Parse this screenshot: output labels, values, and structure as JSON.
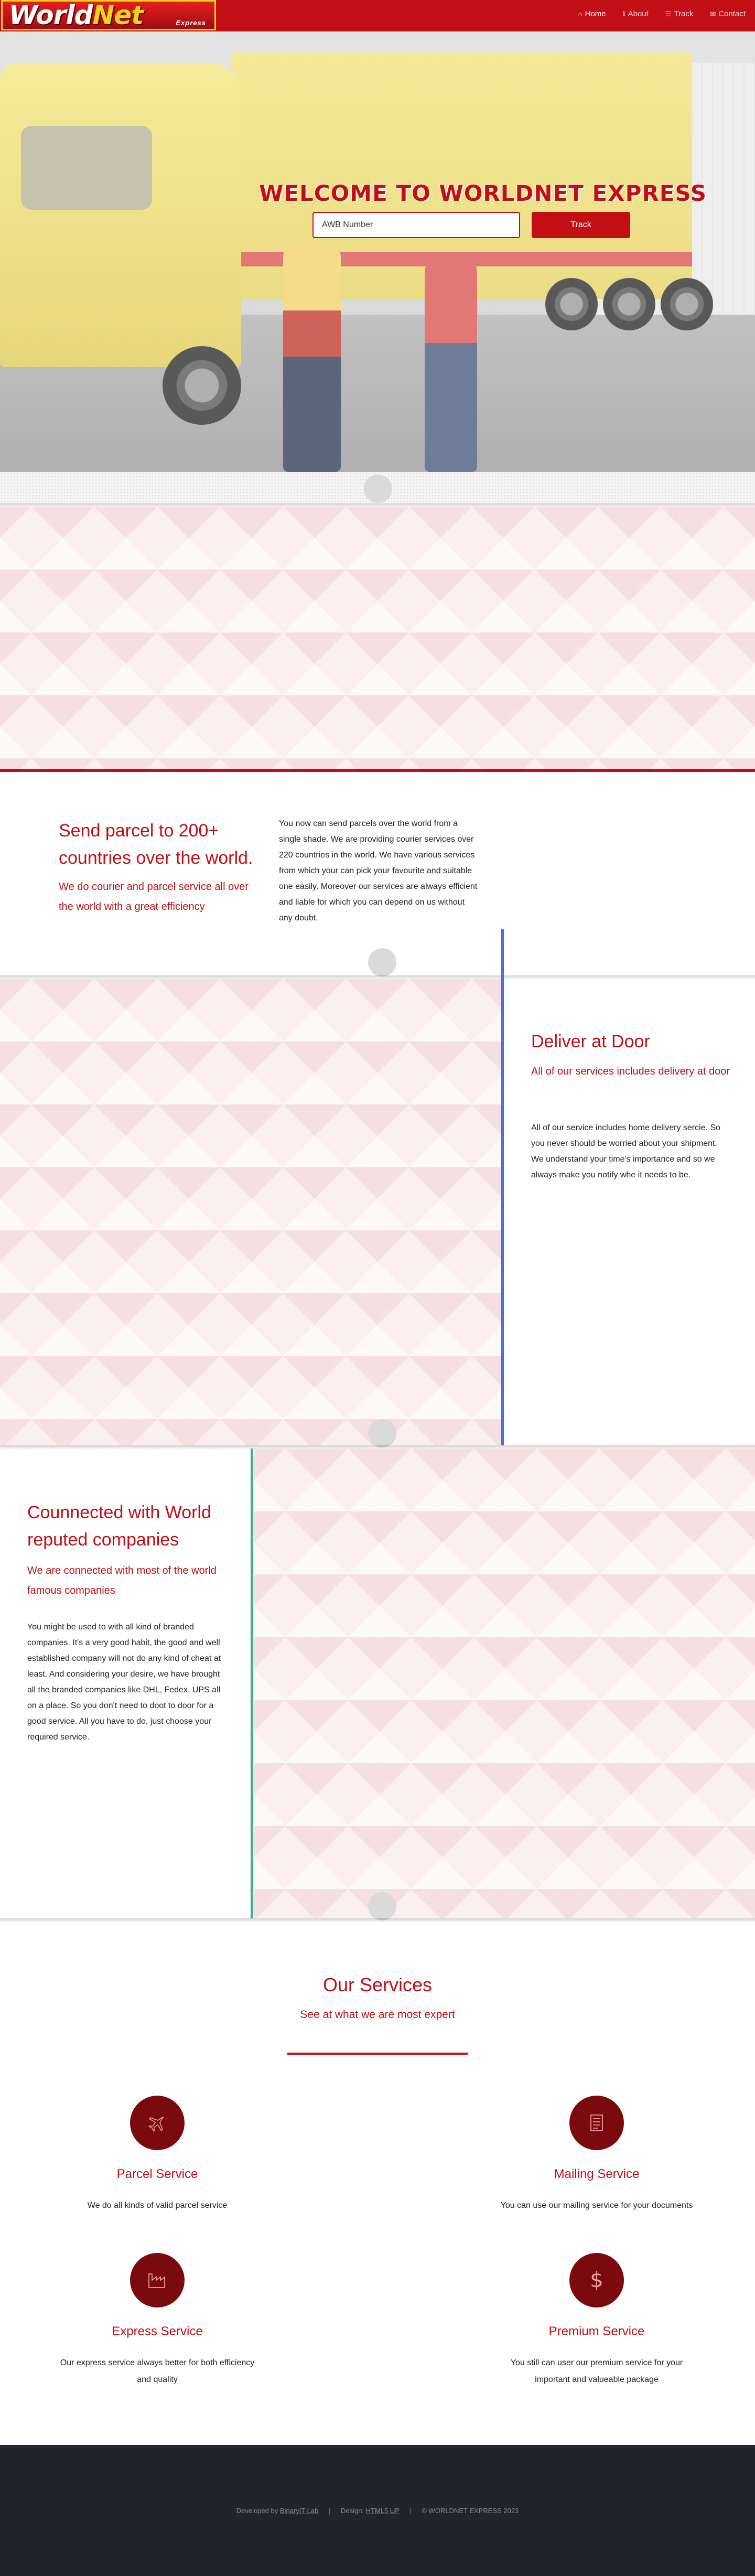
{
  "header": {
    "logo_world": "World",
    "logo_net": "Net",
    "logo_sub": "Express",
    "nav": [
      {
        "label": "Home",
        "icon": "home-icon"
      },
      {
        "label": "About",
        "icon": "info-icon"
      },
      {
        "label": "Track",
        "icon": "list-icon"
      },
      {
        "label": "Contact",
        "icon": "envelope-icon"
      }
    ]
  },
  "hero": {
    "title": "WELCOME TO WORLDNET EXPRESS",
    "awb_placeholder": "AWB Number",
    "track_label": "Track"
  },
  "section_parcel": {
    "title": "Send parcel to 200+ countries over the world.",
    "subtitle": "We do courier and parcel service all over the world with a great efficiency",
    "body": "You now can send parcels over the world from a single shade. We are providing courier services over 220 countries in the world. We have various services from which your can pick your favourite and suitable one easily. Moreover our services are always efficient and liable for which you can depend on us without any doubt."
  },
  "section_door": {
    "title": "Deliver at Door",
    "subtitle": "All of our services includes delivery at door",
    "body": "All of our service includes home delivery sercie. So you never should be worried about your shipment. We understand your time's importance and so we always make you notify whe it needs to be."
  },
  "section_connected": {
    "title": "Counnected with World reputed companies",
    "subtitle": "We are connected with most of the world famous companies",
    "body": "You might be used to with all kind of branded companies. It's a very good habit, the good and well established company will not do any kind of cheat at least. And considering your desire, we have brought all the branded companies like DHL, Fedex, UPS all on a place. So you don't need to doot to door for a good service. All you have to do, just choose your required service."
  },
  "services": {
    "title": "Our Services",
    "subtitle": "See at what we are most expert",
    "items": [
      {
        "name": "Parcel Service",
        "desc": "We do all kinds of valid parcel service",
        "icon": "plane-icon"
      },
      {
        "name": "Mailing Service",
        "desc": "You can use our mailing service for your documents",
        "icon": "document-icon"
      },
      {
        "name": "Express Service",
        "desc": "Our express service always better for both efficiency and quality",
        "icon": "factory-icon"
      },
      {
        "name": "Premium Service",
        "desc": "You still can user our premium service for your important and valueable package",
        "icon": "dollar-icon"
      }
    ]
  },
  "footer": {
    "dev_prefix": "Developed by",
    "dev_link": "BinaryIT Lab",
    "design_prefix": "Design:",
    "design_link": "HTML5 UP",
    "copyright": "© WORLDNET EXPRESS 2023",
    "sep": "|"
  },
  "colors": {
    "brand_red": "#c10f15",
    "dark_red": "#7a0a0d",
    "logo_yellow": "#f3d21c",
    "accent_blue": "#4a6fd6",
    "accent_green": "#35b591",
    "footer_bg": "#23232f"
  }
}
